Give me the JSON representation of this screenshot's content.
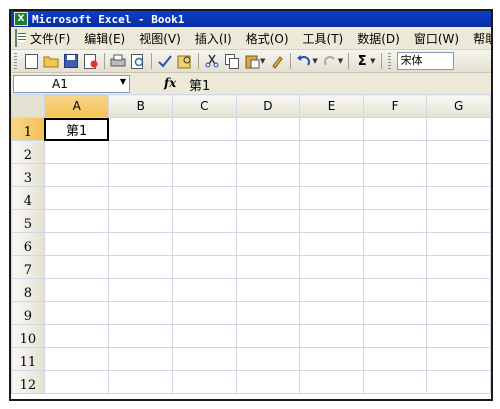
{
  "window": {
    "title": "Microsoft Excel - Book1",
    "app_icon_glyph": "X"
  },
  "menu": {
    "items": [
      "文件(F)",
      "编辑(E)",
      "视图(V)",
      "插入(I)",
      "格式(O)",
      "工具(T)",
      "数据(D)",
      "窗口(W)",
      "帮助(H)"
    ]
  },
  "toolbar": {
    "font_name": "宋体",
    "sum_symbol": "Σ",
    "icons": [
      "new-icon",
      "open-icon",
      "save-icon",
      "permission-icon",
      "print-icon",
      "print-preview-icon",
      "spelling-icon",
      "research-icon",
      "cut-icon",
      "copy-icon",
      "paste-icon",
      "format-painter-icon",
      "undo-icon",
      "redo-icon",
      "autosum-icon"
    ]
  },
  "formula_bar": {
    "name_box": "A1",
    "fx_label": "fx",
    "content": "第1"
  },
  "sheet": {
    "columns": [
      "A",
      "B",
      "C",
      "D",
      "E",
      "F",
      "G"
    ],
    "rows": [
      "1",
      "2",
      "3",
      "4",
      "5",
      "6",
      "7",
      "8",
      "9",
      "10",
      "11",
      "12"
    ],
    "active_cell": {
      "column": "A",
      "row": "1"
    },
    "cells": {
      "A1": "第1"
    }
  },
  "colors": {
    "title_bar": "#0b3fc8",
    "active_header": "#f2c152",
    "ui_face": "#ece9d8"
  }
}
